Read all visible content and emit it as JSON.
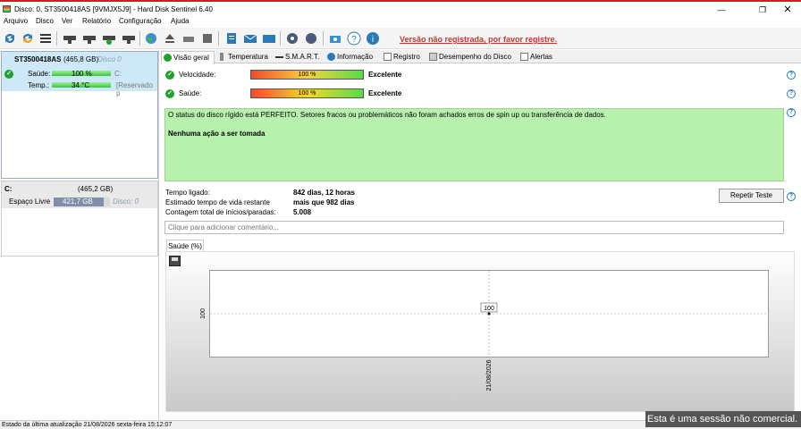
{
  "window": {
    "title": "Disco: 0, ST3500418AS [9VMJX5J9]  -  Hard Disk Sentinel 6.40"
  },
  "menu": [
    "Arquivo",
    "Disco",
    "Ver",
    "Relatório",
    "Configuração",
    "Ajuda"
  ],
  "toolbar": {
    "unregistered_text": "Versão não registrada, por favor registre."
  },
  "left": {
    "disk": {
      "name": "ST3500418AS",
      "size": "(465,8 GB)",
      "disk_label": "Disco 0",
      "health_label": "Saúde:",
      "health_value": "100 %",
      "health_suffix": "C:",
      "temp_label": "Temp.:",
      "temp_value": "34 °C",
      "temp_suffix": "[Reservado p"
    },
    "volume": {
      "name": "C:",
      "size": "(465,2 GB)",
      "free_label": "Espaço Livre",
      "free_value": "421,7 GB",
      "disk_label": "Disco: 0"
    }
  },
  "tabs": [
    "Visão geral",
    "Temperatura",
    "S.M.A.R.T.",
    "Informação",
    "Registro",
    "Desempenho do Disco",
    "Alertas"
  ],
  "overview": {
    "speed_label": "Velocidade:",
    "speed_value": "100 %",
    "speed_rating": "Excelente",
    "health_label": "Saúde:",
    "health_value": "100 %",
    "health_rating": "Excelente",
    "status_message": "O status do disco rígido está PERFEITO. Setores fracos ou problemáticos não foram achados erros de spin up ou transferência de dados.",
    "action": "Nenhuma ação a ser tomada",
    "power_on_label": "Tempo ligado:",
    "power_on_value": "842 dias, 12 horas",
    "lifetime_label": "Estimado tempo de vida restante",
    "lifetime_value": "mais que 982 dias",
    "starts_label": "Contagem total de inícios/paradas:",
    "starts_value": "5.008",
    "repeat_test": "Repetir Teste",
    "comment_placeholder": "Clique para adicionar  comentário..."
  },
  "chart_tab": "Saúde (%)",
  "chart_data": {
    "type": "line",
    "x": [
      "21/08/2026"
    ],
    "y": [
      100
    ],
    "data_labels": [
      "100"
    ],
    "ytick": "100",
    "xtick": "21/08/2026"
  },
  "statusbar": {
    "text": "Estado da última atualização 21/08/2026 sexta-feira 15:12:07",
    "noncommercial": "Esta é uma sessão não comercial."
  },
  "colors": {
    "accent_red": "#c0392b",
    "status_green": "#b8f0ae",
    "check_green": "#1fa12b"
  }
}
